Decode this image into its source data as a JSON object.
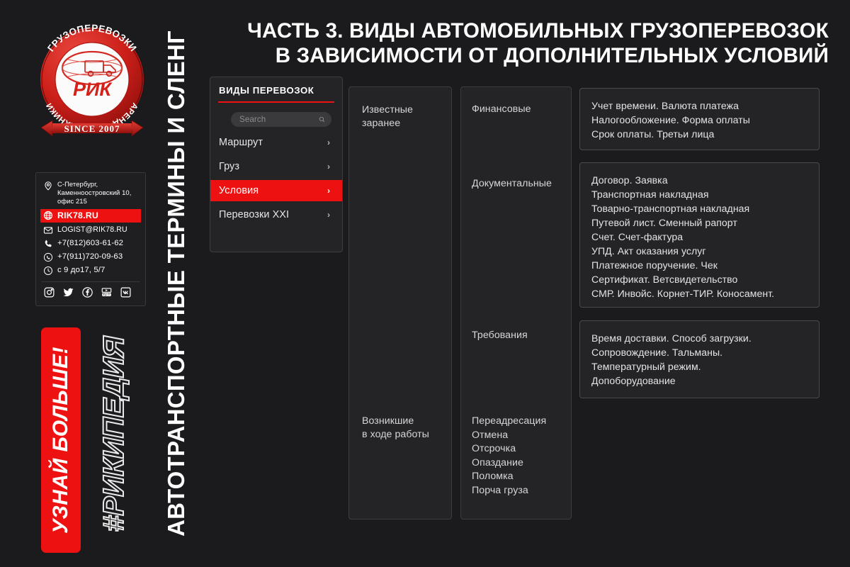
{
  "brand": {
    "logo": {
      "arc_top": "ГРУЗОПЕРЕВОЗКИ",
      "arc_bottom": "АРЕНДА СПЕЦТЕХНИКИ",
      "center": "РИК",
      "ribbon": "SINCE 2007"
    },
    "vertical_title": "АВТОТРАНСПОРТНЫЕ ТЕРМИНЫ И СЛЕНГ",
    "cta": "УЗНАЙ БОЛЬШЕ!",
    "hashtag": "#РИКИПЕДИЯ",
    "accent_color": "#ee1111",
    "background_color": "#1b1b1d"
  },
  "contact": {
    "address": "С-Петербург,\nКаменноостровский 10,\nофис 215",
    "website": "RIK78.RU",
    "email": "LOGIST@RIK78.RU",
    "phone": "+7(812)603-61-62",
    "whatsapp": "+7(911)720-09-63",
    "hours": "с 9 до17,  5/7",
    "icons": {
      "address": "location-pin-icon",
      "website": "globe-icon",
      "email": "envelope-icon",
      "phone": "phone-icon",
      "whatsapp": "whatsapp-icon",
      "hours": "clock-icon"
    },
    "socials": [
      {
        "name": "instagram-icon",
        "label": "Instagram"
      },
      {
        "name": "twitter-icon",
        "label": "Twitter"
      },
      {
        "name": "facebook-icon",
        "label": "Facebook"
      },
      {
        "name": "youtube-icon",
        "label": "YouTube"
      },
      {
        "name": "vk-icon",
        "label": "VK"
      }
    ]
  },
  "header": {
    "line1": "ЧАСТЬ 3. ВИДЫ АВТОМОБИЛЬНЫХ ГРУЗОПЕРЕВОЗОК",
    "line2": "В ЗАВИСИМОСТИ ОТ ДОПОЛНИТЕЛЬНЫХ УСЛОВИЙ"
  },
  "menu": {
    "title": "ВИДЫ ПЕРЕВОЗОК",
    "search_placeholder": "Search",
    "search_value": "",
    "items": [
      {
        "label": "Маршрут",
        "active": false
      },
      {
        "label": "Груз",
        "active": false
      },
      {
        "label": "Условия",
        "active": true
      },
      {
        "label": "Перевозки XXI",
        "active": false
      }
    ],
    "chevron": "›"
  },
  "columns": {
    "conditions": {
      "known": "Известные\nзаранее",
      "arisen": "Возникшие\nв ходе работы"
    },
    "categories": {
      "financial": "Финансовые",
      "documents": "Документальные",
      "requirements": "Требования",
      "arisen_items": [
        "Переадресация",
        "Отмена",
        "Отсрочка",
        "Опаздание",
        "Поломка",
        "Порча груза"
      ]
    }
  },
  "details": {
    "financial": [
      "Учет времени. Валюта платежа",
      "Налогообложение. Форма оплаты",
      "Срок оплаты. Третьи лица"
    ],
    "documents": [
      "Договор. Заявка",
      "Транспортная накладная",
      "Товарно-транспортная накладная",
      "Путевой лист. Сменный рапорт",
      "Счет. Счет-фактура",
      "УПД. Акт оказания услуг",
      "Платежное поручение. Чек",
      "Сертификат. Ветсвидетельство",
      "СМР. Инвойс. Корнет-ТИР. Коносамент."
    ],
    "requirements": [
      "Время доставки. Способ загрузки.",
      "Сопровождение. Тальманы.",
      "Температурный режим.",
      "Допоборудование"
    ]
  }
}
